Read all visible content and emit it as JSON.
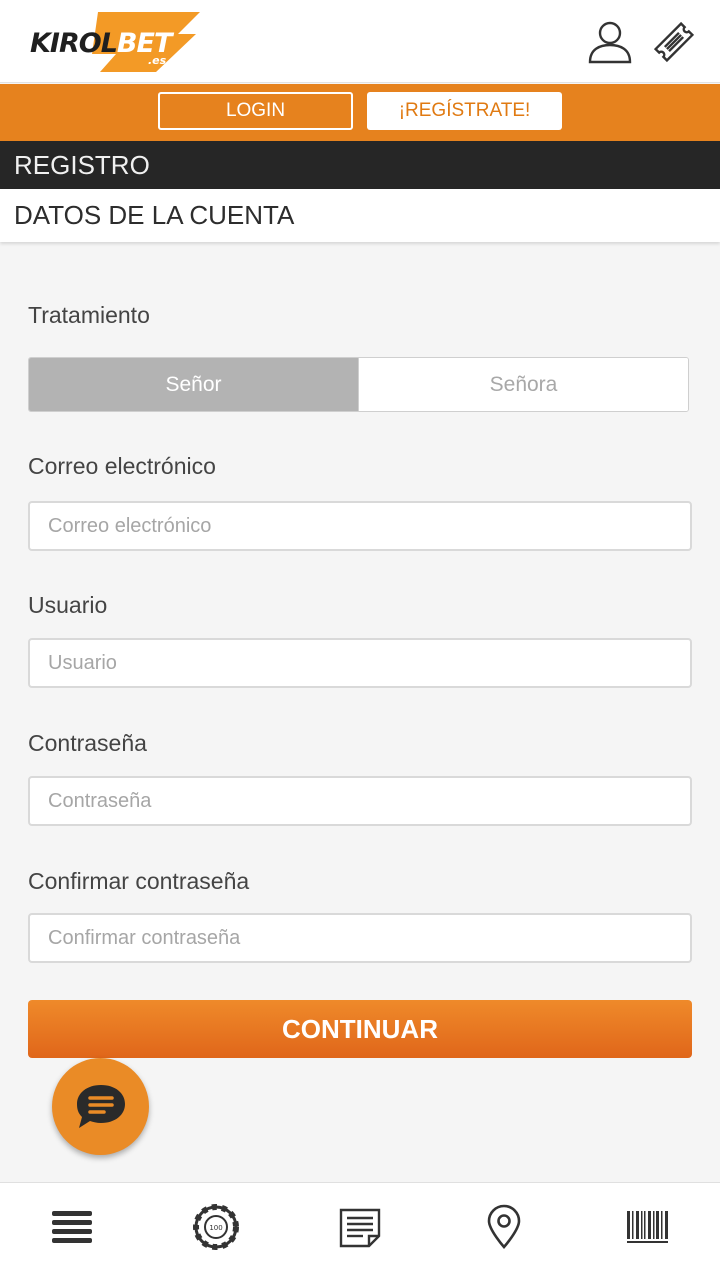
{
  "header": {
    "logo": {
      "brand_dark": "KIROL",
      "brand_light": "BET",
      "suffix": ".es"
    },
    "icons": [
      "user-icon",
      "ticket-icon"
    ]
  },
  "auth": {
    "login_label": "LOGIN",
    "register_label": "¡REGÍSTRATE!"
  },
  "sections": {
    "registro": "REGISTRO",
    "datos_cuenta": "DATOS DE LA CUENTA"
  },
  "form": {
    "tratamiento": {
      "label": "Tratamiento",
      "options": [
        "Señor",
        "Señora"
      ],
      "selected": "Señor"
    },
    "email": {
      "label": "Correo electrónico",
      "placeholder": "Correo electrónico",
      "value": ""
    },
    "usuario": {
      "label": "Usuario",
      "placeholder": "Usuario",
      "value": ""
    },
    "password": {
      "label": "Contraseña",
      "placeholder": "Contraseña",
      "value": ""
    },
    "confirm": {
      "label": "Confirmar contraseña",
      "placeholder": "Confirmar contraseña",
      "value": ""
    },
    "continue_label": "CONTINUAR"
  },
  "chat": {
    "icon": "chat-bubble-icon"
  },
  "bottom_nav": {
    "items": [
      "menu-icon",
      "casino-chip-icon",
      "news-icon",
      "location-pin-icon",
      "barcode-icon"
    ]
  },
  "colors": {
    "brand_orange": "#e6821e",
    "dark_bar": "#262626",
    "toggle_active": "#b3b3b3",
    "continue_top": "#ef8a2a",
    "continue_bottom": "#e0661a"
  }
}
